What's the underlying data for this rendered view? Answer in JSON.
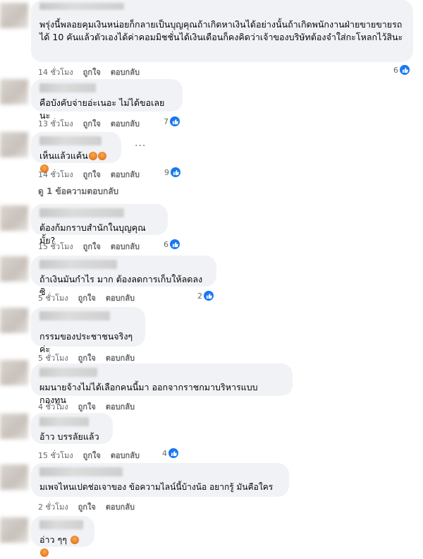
{
  "labels": {
    "like": "ถูกใจ",
    "reply": "ตอบกลับ"
  },
  "view_replies": "ดู 1 ข้อความตอบกลับ",
  "comments": [
    {
      "text": "พรุ่งนี้พลอยคุมเงินหน่อยก็กลายเป็นบุญคุณถ้าเกิดหาเงินได้อย่างนั้นถ้าเกิดพนักงานฝ่ายขายขายรถได้ 10 คันแล้วตัวเองได้ค่าคอมมิชชั่นได้เงินเดือนก็คงคิดว่าเจ้าของบริษัทต้องจำใส่กะโหลกไว้สินะ",
      "time": "14 ชั่วโมง",
      "reactions": "6"
    },
    {
      "text": "คือบังคับจ่ายอ่ะเนอะ ไม่ได้ขอเลยนะ",
      "time": "13 ชั่วโมง",
      "reactions": "7"
    },
    {
      "text": "เห็นแล้วแค้น",
      "time": "14 ชั่วโมง",
      "reactions": "9"
    },
    {
      "text": "ต้องก้มกราบสำนักในบุญคุณมั้ย?",
      "time": "15 ชั่วโมง",
      "reactions": "6"
    },
    {
      "text": "ถ้าเงินมันกำไร มาก ต้องลดการเก็บให้ลดลงซิ",
      "time": "5 ชั่วโมง",
      "reactions": "2"
    },
    {
      "text": "กรรมของประชาชนจริงๆค่ะ",
      "time": "5 ชั่วโมง",
      "reactions": ""
    },
    {
      "text": "ผมนายจ้างไม่ได้เลือกคนนี้มา ออกจากราชกมาบริหารแบบกองทุน",
      "time": "4 ชั่วโมง",
      "reactions": ""
    },
    {
      "text": "อ้าว บรรลัยแล้ว",
      "time": "15 ชั่วโมง",
      "reactions": "4"
    },
    {
      "text": "มเพจไหนเปดช่อเจาของ ข้อความไลน์นี้บ้างน้อ อยากรู้ มันคือใคร",
      "time": "2 ชั่วโมง",
      "reactions": ""
    },
    {
      "text": "อ่าว ๆๆ",
      "time": "",
      "reactions": ""
    }
  ],
  "icons": {
    "like": "like-icon",
    "angry": "angry-emoji",
    "more": "more-options-icon"
  },
  "colors": {
    "like_blue": "#1877f2",
    "bubble": "#f0f2f5",
    "meta": "#65676b"
  }
}
